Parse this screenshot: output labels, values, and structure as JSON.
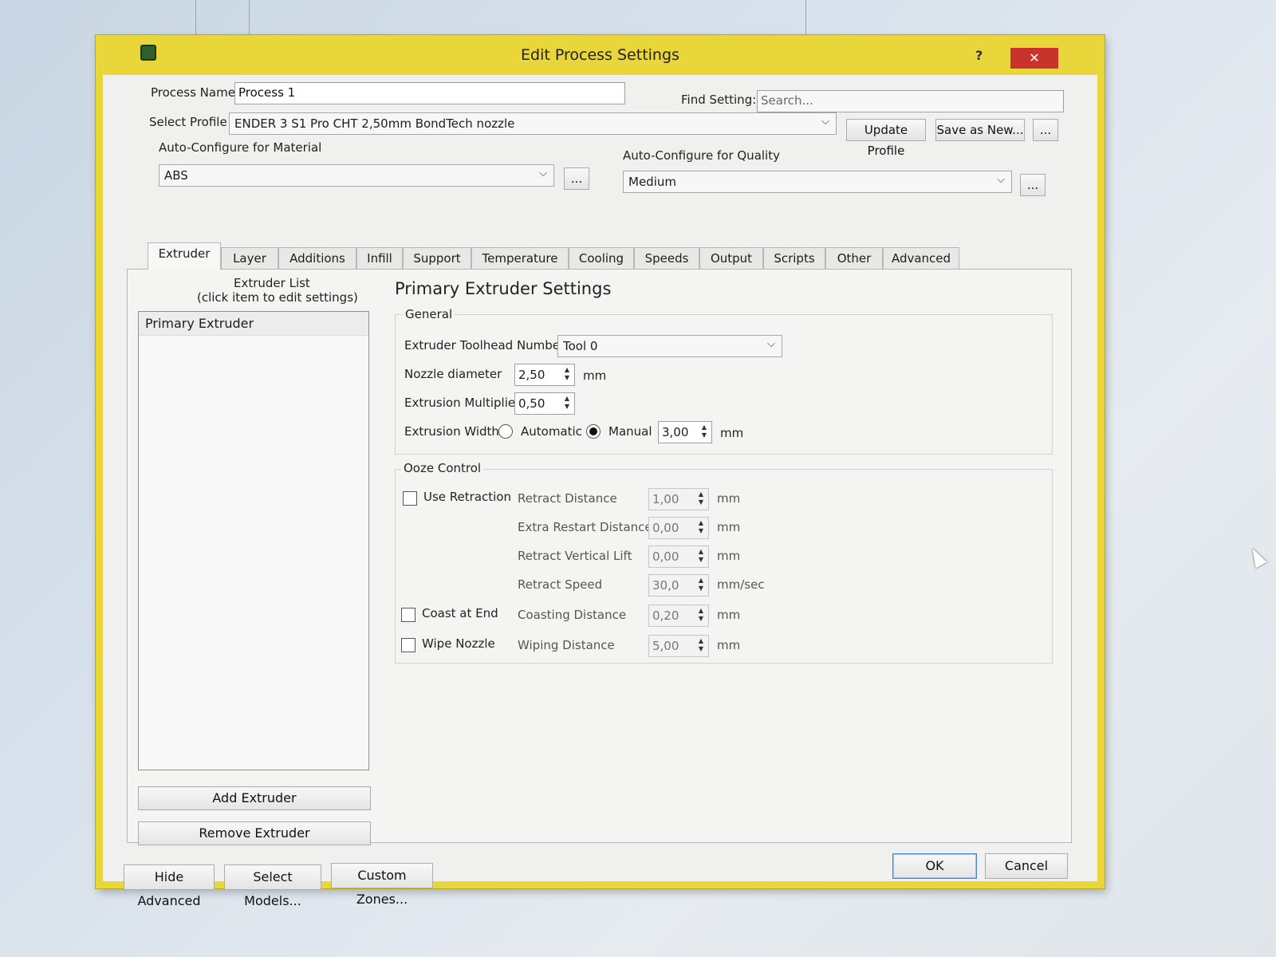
{
  "window": {
    "title": "Edit Process Settings",
    "help_label": "?",
    "close_label": "✕"
  },
  "process_name": {
    "label": "Process Name",
    "value": "Process 1"
  },
  "find_setting": {
    "label": "Find Setting:",
    "placeholder": "Search..."
  },
  "profile": {
    "label": "Select Profile",
    "value": "ENDER 3 S1 Pro CHT 2,50mm BondTech nozzle",
    "update_label": "Update Profile",
    "save_new_label": "Save as New...",
    "more_label": "..."
  },
  "material": {
    "label": "Auto-Configure for Material",
    "value": "ABS",
    "more_label": "..."
  },
  "quality": {
    "label": "Auto-Configure for Quality",
    "value": "Medium",
    "more_label": "..."
  },
  "tabs": [
    "Extruder",
    "Layer",
    "Additions",
    "Infill",
    "Support",
    "Temperature",
    "Cooling",
    "Speeds",
    "Output",
    "Scripts",
    "Other",
    "Advanced"
  ],
  "active_tab": "Extruder",
  "extruder_list": {
    "title": "Extruder List",
    "subtitle": "(click item to edit settings)",
    "items": [
      "Primary Extruder"
    ],
    "add_label": "Add Extruder",
    "remove_label": "Remove Extruder"
  },
  "settings": {
    "heading": "Primary Extruder Settings",
    "general": {
      "title": "General",
      "toolhead": {
        "label": "Extruder Toolhead Number",
        "value": "Tool 0"
      },
      "nozzle": {
        "label": "Nozzle diameter",
        "value": "2,50",
        "unit": "mm"
      },
      "multiplier": {
        "label": "Extrusion Multiplier",
        "value": "0,50"
      },
      "width": {
        "label": "Extrusion Width",
        "automatic_label": "Automatic",
        "manual_label": "Manual",
        "value": "3,00",
        "unit": "mm",
        "mode": "Manual"
      }
    },
    "ooze": {
      "title": "Ooze Control",
      "use_retraction": {
        "label": "Use Retraction",
        "checked": false
      },
      "retract_distance": {
        "label": "Retract Distance",
        "value": "1,00",
        "unit": "mm"
      },
      "extra_restart": {
        "label": "Extra Restart Distance",
        "value": "0,00",
        "unit": "mm"
      },
      "vertical_lift": {
        "label": "Retract Vertical Lift",
        "value": "0,00",
        "unit": "mm"
      },
      "retract_speed": {
        "label": "Retract Speed",
        "value": "30,0",
        "unit": "mm/sec"
      },
      "coast": {
        "label": "Coast at End",
        "checked": false
      },
      "coasting_distance": {
        "label": "Coasting Distance",
        "value": "0,20",
        "unit": "mm"
      },
      "wipe": {
        "label": "Wipe Nozzle",
        "checked": false
      },
      "wiping_distance": {
        "label": "Wiping Distance",
        "value": "5,00",
        "unit": "mm"
      }
    }
  },
  "footer": {
    "hide_advanced_label": "Hide Advanced",
    "select_models_label": "Select Models...",
    "custom_zones_label": "Custom Zones...",
    "ok_label": "OK",
    "cancel_label": "Cancel"
  }
}
